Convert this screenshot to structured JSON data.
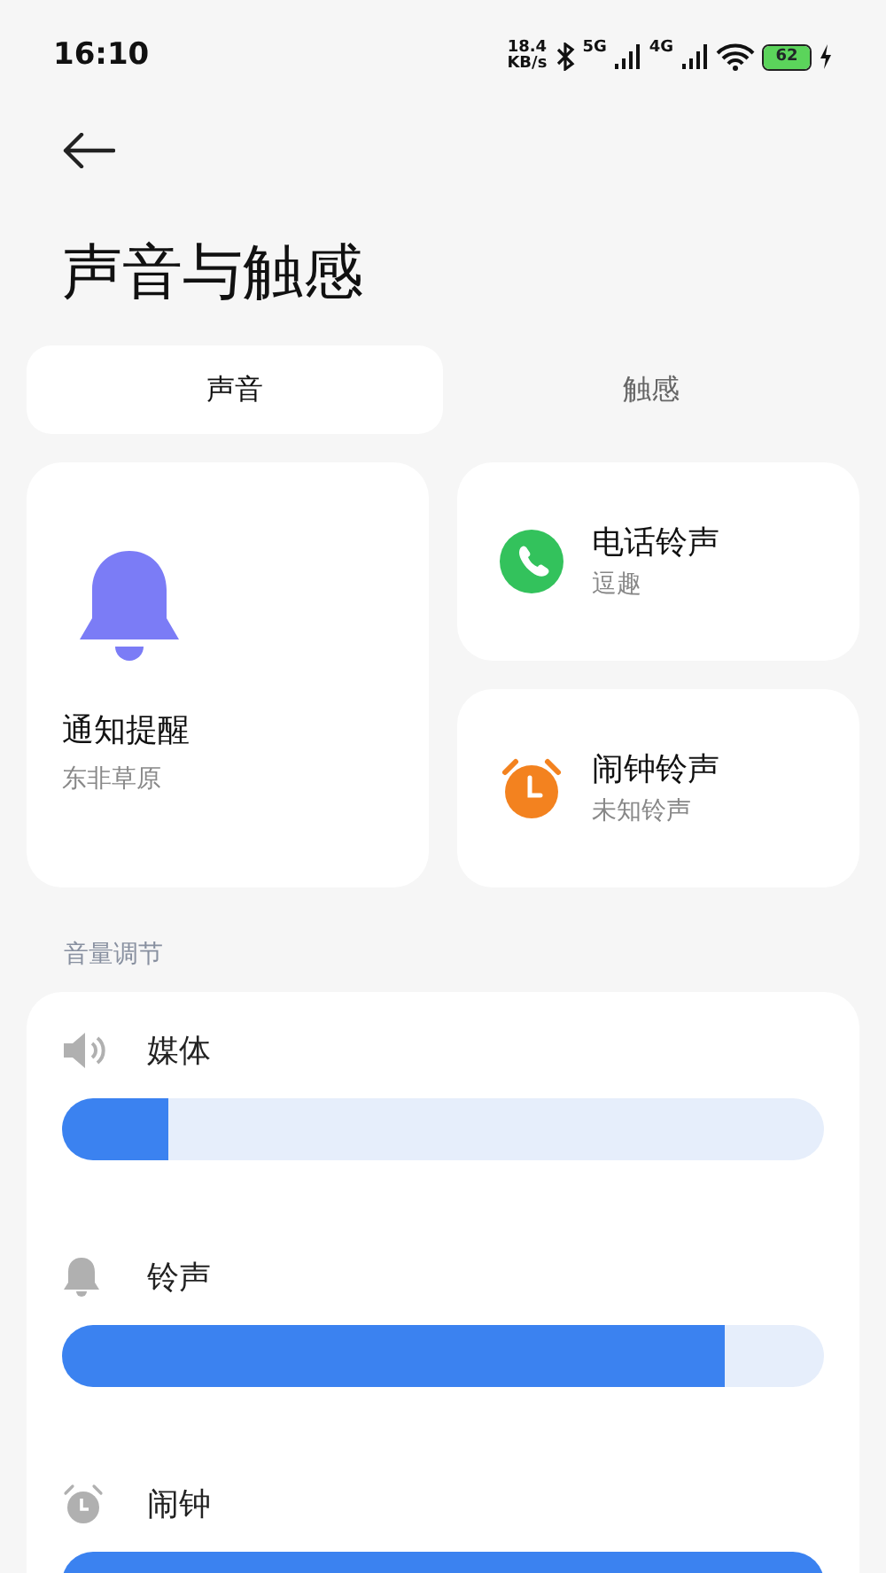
{
  "status_bar": {
    "time": "16:10",
    "net_speed": "18.4",
    "net_unit": "KB/s",
    "sim_1": "5G",
    "sim_2": "4G",
    "battery": "62"
  },
  "title": "声音与触感",
  "tabs": [
    {
      "label": "声音",
      "selected": true
    },
    {
      "label": "触感",
      "selected": false
    }
  ],
  "sound_cards": [
    {
      "kind": "notification",
      "title": "通知提醒",
      "subtitle": "东非草原"
    },
    {
      "kind": "phone",
      "title": "电话铃声",
      "subtitle": "逗趣"
    },
    {
      "kind": "alarm",
      "title": "闹钟铃声",
      "subtitle": "未知铃声"
    }
  ],
  "volume_section": {
    "heading": "音量调节",
    "channels": [
      {
        "kind": "media",
        "name": "媒体",
        "level": 0.14
      },
      {
        "kind": "ring",
        "name": "铃声",
        "level": 0.87
      },
      {
        "kind": "alarm",
        "name": "闹钟",
        "level": 1
      }
    ]
  }
}
